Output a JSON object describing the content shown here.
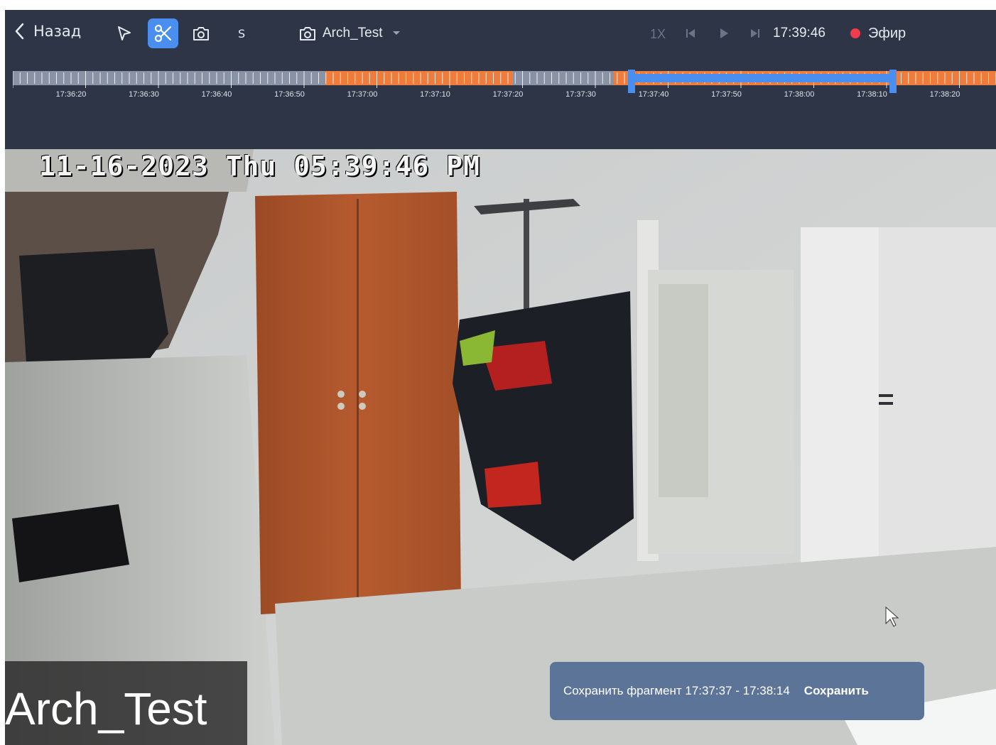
{
  "toolbar": {
    "back_label": "Назад",
    "speed_label": "S",
    "camera_name": "Arch_Test",
    "playback_speed": "1X",
    "current_time": "17:39:46",
    "live_label": "Эфир",
    "live_color": "#f23b4b",
    "active_tool_color": "#4a8ff0"
  },
  "timeline": {
    "tick_labels": [
      "17:36:20",
      "17:36:30",
      "17:36:40",
      "17:36:50",
      "17:37:00",
      "17:37:10",
      "17:37:20",
      "17:37:30",
      "17:37:40",
      "17:37:50",
      "17:38:00",
      "17:38:10",
      "17:38:20"
    ],
    "recorded_color": "#ef7c3a",
    "empty_color": "#8a93a6",
    "selection_color": "#4a8ff0",
    "selection_start": "17:37:37",
    "selection_end": "17:38:14"
  },
  "video": {
    "osd_timestamp": "11-16-2023 Thu 05:39:46 PM",
    "camera_label": "Arch_Test"
  },
  "toast": {
    "message": "Сохранить фрагмент 17:37:37 - 17:38:14",
    "save_label": "Сохранить"
  },
  "icons": [
    "chevron-left-icon",
    "pointer-icon",
    "scissors-icon",
    "camera-icon",
    "camera-icon",
    "dropdown-icon",
    "skip-back-icon",
    "play-icon",
    "skip-forward-icon",
    "live-dot-icon"
  ]
}
